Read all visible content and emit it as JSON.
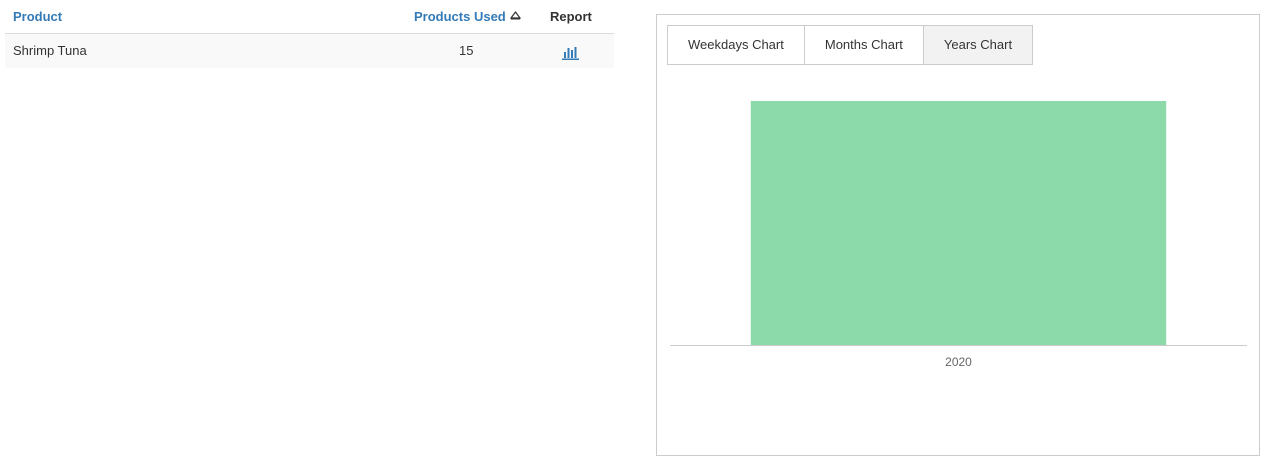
{
  "table": {
    "headers": {
      "product": "Product",
      "products_used": "Products Used",
      "report": "Report"
    },
    "rows": [
      {
        "product": "Shrimp Tuna",
        "products_used": "15",
        "report_icon": "bar-chart-icon"
      }
    ],
    "sort": {
      "column": "products_used",
      "direction": "ascending"
    }
  },
  "chart_panel": {
    "tabs": [
      {
        "label": "Weekdays Chart",
        "active": false
      },
      {
        "label": "Months Chart",
        "active": false
      },
      {
        "label": "Years Chart",
        "active": true
      }
    ]
  },
  "colors": {
    "link": "#337ab7",
    "bar": "#8cdaa9",
    "axis": "#cccccc"
  },
  "chart_data": {
    "type": "bar",
    "categories": [
      "2020"
    ],
    "values": [
      15
    ],
    "title": "",
    "xlabel": "",
    "ylabel": "",
    "ylim": [
      0,
      15
    ],
    "grid": false,
    "legend": "none"
  }
}
